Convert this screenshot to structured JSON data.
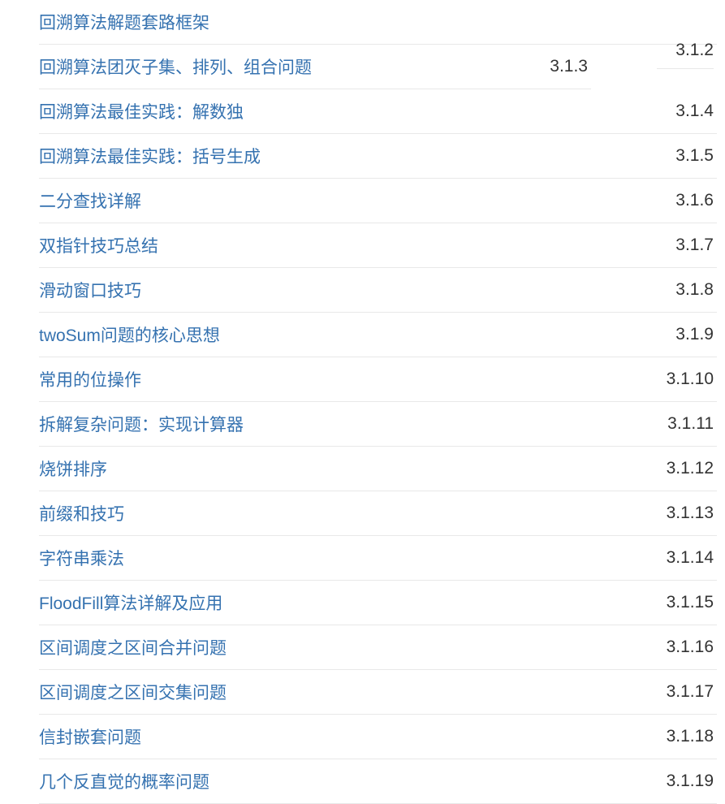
{
  "toc": {
    "floating_number": "3.1.2",
    "items": [
      {
        "title": "回溯算法解题套路框架",
        "number": "",
        "narrow": false
      },
      {
        "title": "回溯算法团灭子集、排列、组合问题",
        "number": "3.1.3",
        "narrow": true
      },
      {
        "title": "回溯算法最佳实践：解数独",
        "number": "3.1.4",
        "narrow": false
      },
      {
        "title": "回溯算法最佳实践：括号生成",
        "number": "3.1.5",
        "narrow": false
      },
      {
        "title": "二分查找详解",
        "number": "3.1.6",
        "narrow": false
      },
      {
        "title": "双指针技巧总结",
        "number": "3.1.7",
        "narrow": false
      },
      {
        "title": "滑动窗口技巧",
        "number": "3.1.8",
        "narrow": false
      },
      {
        "title": "twoSum问题的核心思想",
        "number": "3.1.9",
        "narrow": false
      },
      {
        "title": "常用的位操作",
        "number": "3.1.10",
        "narrow": false
      },
      {
        "title": "拆解复杂问题：实现计算器",
        "number": "3.1.11",
        "narrow": false
      },
      {
        "title": "烧饼排序",
        "number": "3.1.12",
        "narrow": false
      },
      {
        "title": "前缀和技巧",
        "number": "3.1.13",
        "narrow": false
      },
      {
        "title": "字符串乘法",
        "number": "3.1.14",
        "narrow": false
      },
      {
        "title": "FloodFill算法详解及应用",
        "number": "3.1.15",
        "narrow": false
      },
      {
        "title": "区间调度之区间合并问题",
        "number": "3.1.16",
        "narrow": false
      },
      {
        "title": "区间调度之区间交集问题",
        "number": "3.1.17",
        "narrow": false
      },
      {
        "title": "信封嵌套问题",
        "number": "3.1.18",
        "narrow": false
      },
      {
        "title": "几个反直觉的概率问题",
        "number": "3.1.19",
        "narrow": false
      }
    ]
  }
}
